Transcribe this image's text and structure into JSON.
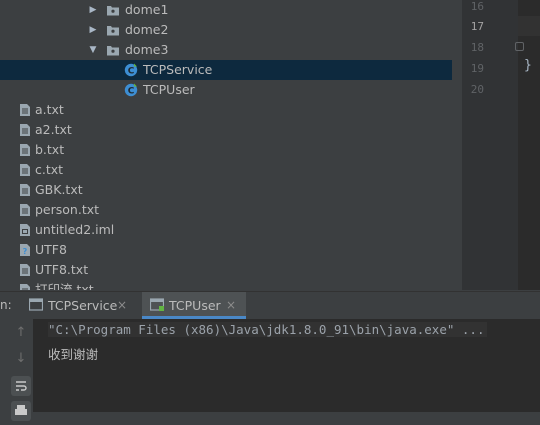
{
  "project_tree": {
    "folders": [
      {
        "label": "dome1",
        "expanded": false
      },
      {
        "label": "dome2",
        "expanded": false
      },
      {
        "label": "dome3",
        "expanded": true
      }
    ],
    "classes": [
      {
        "label": "TCPService",
        "selected": true
      },
      {
        "label": "TCPUser",
        "selected": false
      }
    ],
    "files": [
      {
        "label": "a.txt",
        "icon": "text-file-icon"
      },
      {
        "label": "a2.txt",
        "icon": "text-file-icon"
      },
      {
        "label": "b.txt",
        "icon": "text-file-icon"
      },
      {
        "label": "c.txt",
        "icon": "text-file-icon"
      },
      {
        "label": "GBK.txt",
        "icon": "text-file-icon"
      },
      {
        "label": "person.txt",
        "icon": "text-file-icon"
      },
      {
        "label": "untitled2.iml",
        "icon": "module-file-icon"
      },
      {
        "label": "UTF8",
        "icon": "unknown-file-icon"
      },
      {
        "label": "UTF8.txt",
        "icon": "text-file-icon"
      },
      {
        "label": "打印流.txt",
        "icon": "text-file-icon"
      }
    ]
  },
  "editor": {
    "line_numbers": [
      "16",
      "17",
      "18",
      "19",
      "20"
    ],
    "current_line": "17",
    "brace": "}"
  },
  "run_panel": {
    "prefix": "n:",
    "tabs": [
      {
        "label": "TCPService",
        "active": false
      },
      {
        "label": "TCPUser",
        "active": true
      }
    ],
    "close_glyph": "×",
    "console_lines": [
      "\"C:\\Program Files (x86)\\Java\\jdk1.8.0_91\\bin\\java.exe\" ...",
      "收到谢谢"
    ]
  },
  "colors": {
    "background": "#3c3f41",
    "selection": "#0d293e",
    "editor_bg": "#2b2b2b",
    "class_icon": "#3d8ed3",
    "accent": "#4a88c7"
  }
}
